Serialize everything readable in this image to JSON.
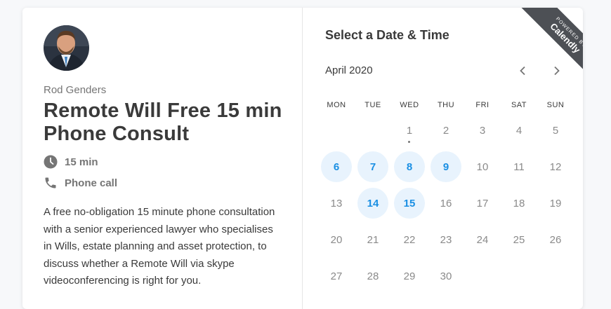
{
  "host": {
    "name": "Rod Genders"
  },
  "event": {
    "title": "Remote Will Free 15 min Phone Consult",
    "duration": "15 min",
    "location": "Phone call",
    "description": "A free no-obligation 15 minute phone consultation with a senior experienced lawyer who specialises in Wills, estate planning and asset protection, to discuss whether a Remote Will via skype videoconferencing is right for you."
  },
  "scheduler": {
    "heading": "Select a Date & Time",
    "month_label": "April 2020",
    "weekdays": [
      "MON",
      "TUE",
      "WED",
      "THU",
      "FRI",
      "SAT",
      "SUN"
    ],
    "weeks": [
      [
        "",
        "",
        "1",
        "2",
        "3",
        "4",
        "5"
      ],
      [
        "6",
        "7",
        "8",
        "9",
        "10",
        "11",
        "12"
      ],
      [
        "13",
        "14",
        "15",
        "16",
        "17",
        "18",
        "19"
      ],
      [
        "20",
        "21",
        "22",
        "23",
        "24",
        "25",
        "26"
      ],
      [
        "27",
        "28",
        "29",
        "30",
        "",
        "",
        ""
      ]
    ],
    "available_days": [
      "6",
      "7",
      "8",
      "9",
      "14",
      "15"
    ],
    "today": "1"
  },
  "badge": {
    "line1": "POWERED BY",
    "line2": "Calendly"
  },
  "colors": {
    "accent": "#1a8fe3",
    "available_bg": "#e8f3fd",
    "ribbon": "#4d5055"
  },
  "icons": {
    "duration": "clock-icon",
    "location": "phone-icon",
    "prev": "chevron-left-icon",
    "next": "chevron-right-icon"
  }
}
